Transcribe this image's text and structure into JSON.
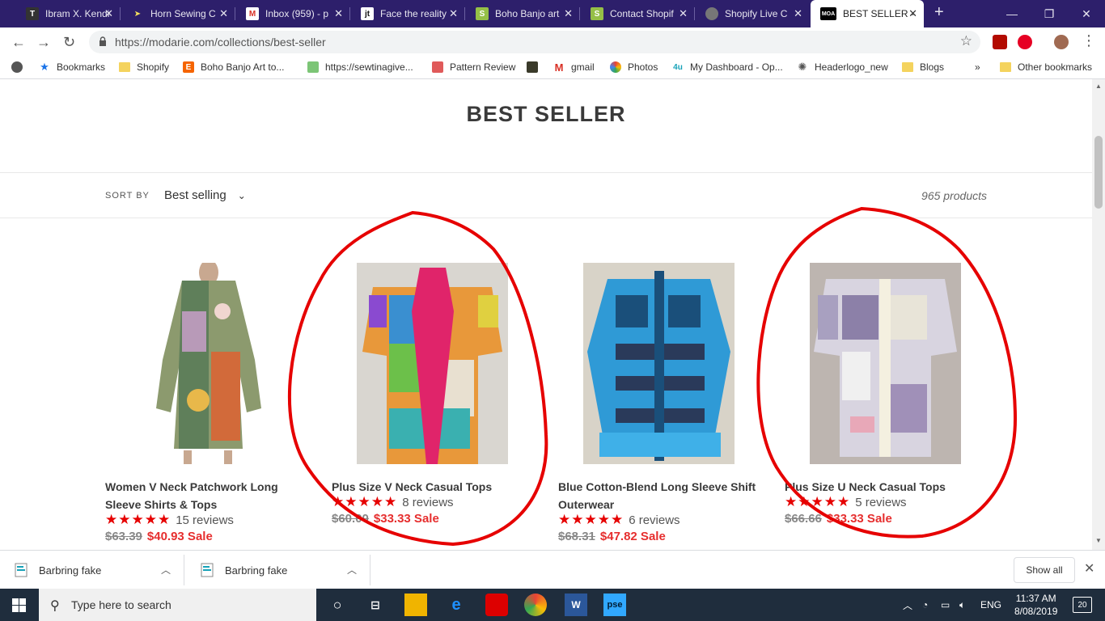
{
  "browser": {
    "tabs": [
      {
        "title": "Ibram X. Kendi",
        "fav_bg": "#333333",
        "fav_text": "T"
      },
      {
        "title": "Horn Sewing C",
        "fav_bg": "#2d1f6b",
        "fav_text": ""
      },
      {
        "title": "Inbox (959) - p",
        "fav_bg": "#ffffff",
        "fav_text": "M"
      },
      {
        "title": "Face the reality",
        "fav_bg": "#ffffff",
        "fav_text": "jt"
      },
      {
        "title": "Boho Banjo art",
        "fav_bg": "#95bf47",
        "fav_text": ""
      },
      {
        "title": "Contact Shopif",
        "fav_bg": "#95bf47",
        "fav_text": ""
      },
      {
        "title": "Shopify Live C",
        "fav_bg": "#888888",
        "fav_text": ""
      },
      {
        "title": "BEST SELLER -",
        "fav_bg": "#000000",
        "fav_text": "MOA",
        "active": true
      }
    ],
    "url": "https://modarie.com/collections/best-seller",
    "bookmarks": [
      {
        "label": "Bookmarks",
        "icon": "star-icon"
      },
      {
        "label": "Shopify",
        "icon": "folder-icon"
      },
      {
        "label": "Boho Banjo Art to...",
        "icon": "etsy-icon"
      },
      {
        "label": "https://sewtinagive...",
        "icon": "link-icon"
      },
      {
        "label": "Pattern Review",
        "icon": "pattern-icon"
      },
      {
        "label": "",
        "icon": "image-icon"
      },
      {
        "label": "gmail",
        "icon": "gmail-icon"
      },
      {
        "label": "Photos",
        "icon": "photos-icon"
      },
      {
        "label": "My Dashboard - Op...",
        "icon": "dashboard-icon"
      },
      {
        "label": "Headerlogo_new",
        "icon": "logo-icon"
      },
      {
        "label": "Blogs",
        "icon": "folder-icon"
      },
      {
        "label": "Other bookmarks",
        "icon": "folder-icon"
      }
    ],
    "overflow": "»"
  },
  "page": {
    "title": "BEST SELLER",
    "sort_label": "SORT BY",
    "sort_value": "Best selling",
    "product_count": "965 products",
    "products": [
      {
        "name": "Women V Neck Patchwork Long Sleeve Shirts & Tops",
        "stars": "★★★★★",
        "reviews": "15 reviews",
        "was": "$63.39",
        "now": "$40.93 Sale"
      },
      {
        "name": "Plus Size V Neck Casual Tops",
        "stars": "★★★★★",
        "reviews": "8 reviews",
        "was": "$60.00",
        "now": "$33.33 Sale"
      },
      {
        "name": "Blue Cotton-Blend Long Sleeve Shift Outerwear",
        "stars": "★★★★★",
        "reviews": "6 reviews",
        "was": "$68.31",
        "now": "$47.82 Sale"
      },
      {
        "name": "Plus Size U Neck Casual Tops",
        "stars": "★★★★★",
        "reviews": "5 reviews",
        "was": "$66.66",
        "now": "$33.33 Sale"
      }
    ],
    "accent_color": "#e62e2e",
    "annotation_color": "#e60000"
  },
  "downloads": {
    "items": [
      "Barbring fake",
      "Barbring fake"
    ],
    "show_all": "Show all"
  },
  "taskbar": {
    "search_placeholder": "Type here to search",
    "language": "ENG",
    "time": "11:37 AM",
    "date": "8/08/2019",
    "notifications": "20"
  }
}
